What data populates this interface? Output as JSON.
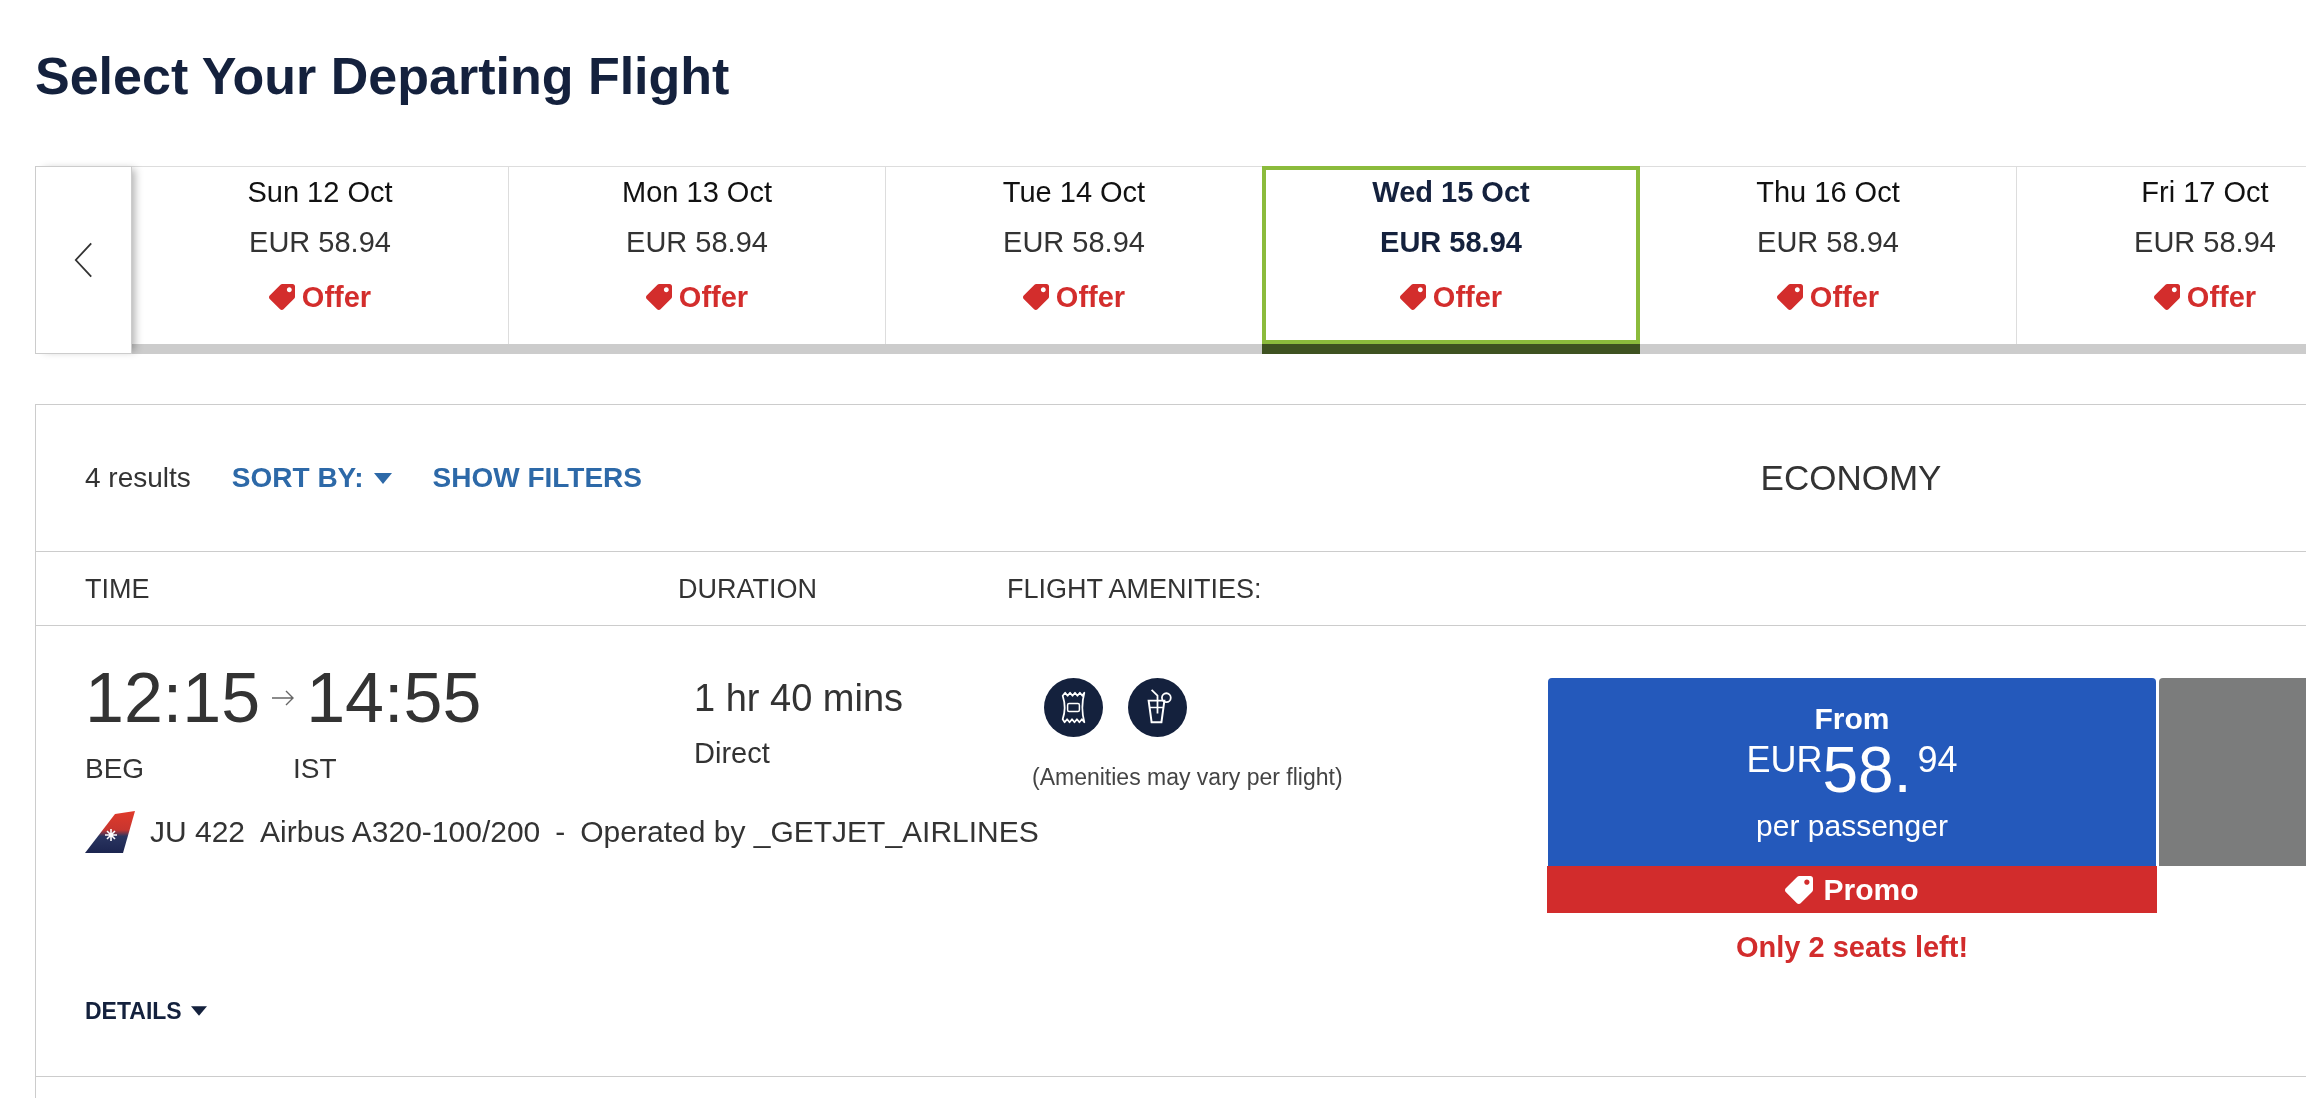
{
  "page_title": "Select Your Departing Flight",
  "date_strip": {
    "days": [
      {
        "date": "Sun 12 Oct",
        "price": "EUR 58.94",
        "badge": "Offer",
        "selected": false
      },
      {
        "date": "Mon 13 Oct",
        "price": "EUR 58.94",
        "badge": "Offer",
        "selected": false
      },
      {
        "date": "Tue 14 Oct",
        "price": "EUR 58.94",
        "badge": "Offer",
        "selected": false
      },
      {
        "date": "Wed 15 Oct",
        "price": "EUR 58.94",
        "badge": "Offer",
        "selected": true
      },
      {
        "date": "Thu 16 Oct",
        "price": "EUR 58.94",
        "badge": "Offer",
        "selected": false
      },
      {
        "date": "Fri 17 Oct",
        "price": "EUR 58.94",
        "badge": "Offer",
        "selected": false
      }
    ]
  },
  "results": {
    "count": "4 results",
    "sort_label": "SORT BY:",
    "filters_label": "SHOW FILTERS",
    "cabin": "ECONOMY",
    "columns": [
      "TIME",
      "DURATION",
      "FLIGHT AMENITIES:"
    ],
    "flights": [
      {
        "departure_time": "12:15",
        "arrival_time": "14:55",
        "origin": "BEG",
        "destination": "IST",
        "flight_info": [
          "JU 422",
          "Airbus A320-100/200",
          "-",
          "Operated by _GETJET_AIRLINES"
        ],
        "duration": "1 hr 40 mins",
        "stops": "Direct",
        "amenities": [
          {
            "kind": "snack"
          },
          {
            "kind": "drink"
          }
        ],
        "amenities_note": "(Amenities may vary per flight)",
        "fare": {
          "label": "From",
          "currency": "EUR",
          "whole": "58.",
          "fraction": "94",
          "unit": "per passenger",
          "badge": "Promo",
          "availability": "Only 2 seats left!"
        },
        "details_label": "DETAILS"
      }
    ]
  }
}
